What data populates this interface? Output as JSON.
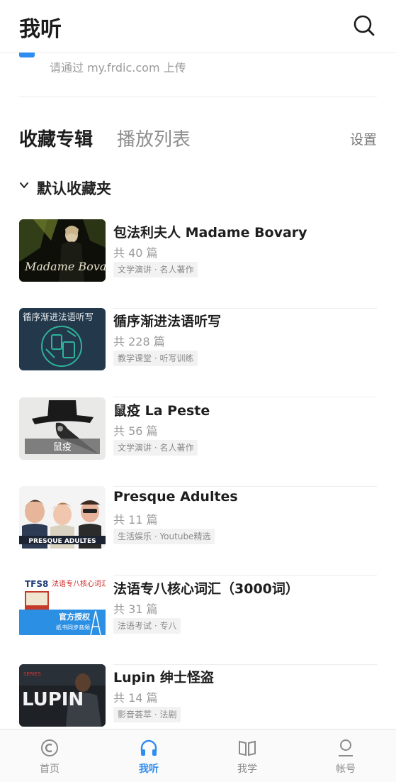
{
  "header": {
    "title": "我听"
  },
  "upload": {
    "hint": "请通过 my.frdic.com 上传"
  },
  "tabs": {
    "favorites": "收藏专辑",
    "playlist": "播放列表",
    "settings": "设置"
  },
  "folder": {
    "name": "默认收藏夹"
  },
  "albums": [
    {
      "title": "包法利夫人 Madame Bovary",
      "count": "共 40 篇",
      "tag": "文学演讲 · 名人著作",
      "cover_text": "Madame Bovary"
    },
    {
      "title": "循序渐进法语听写",
      "count": "共 228 篇",
      "tag": "教学课堂 · 听写训练",
      "cover_text": "循序渐进法语听写"
    },
    {
      "title": "鼠疫 La Peste",
      "count": "共 56 篇",
      "tag": "文学演讲 · 名人著作",
      "cover_text": "鼠疫"
    },
    {
      "title": "Presque Adultes",
      "count": "共 11 篇",
      "tag": "生活娱乐 · Youtube精选",
      "cover_text": "PRESQUE ADULTES"
    },
    {
      "title": "法语专八核心词汇（3000词）",
      "count": "共 31 篇",
      "tag": "法语考试 · 专八",
      "cover_text_1": "TFS8",
      "cover_text_2": "法语专八核心词汇",
      "cover_text_3": "官方授权",
      "cover_text_4": "纸书同步音频"
    },
    {
      "title": "Lupin 绅士怪盗",
      "count": "共 14 篇",
      "tag": "影音荟萃 · 法剧",
      "cover_text": "LUPIN",
      "cover_text_small": "SERIES"
    }
  ],
  "nav": {
    "home": "首页",
    "listen": "我听",
    "study": "我学",
    "account": "帐号"
  },
  "colors": {
    "accent": "#2f8cf0"
  }
}
